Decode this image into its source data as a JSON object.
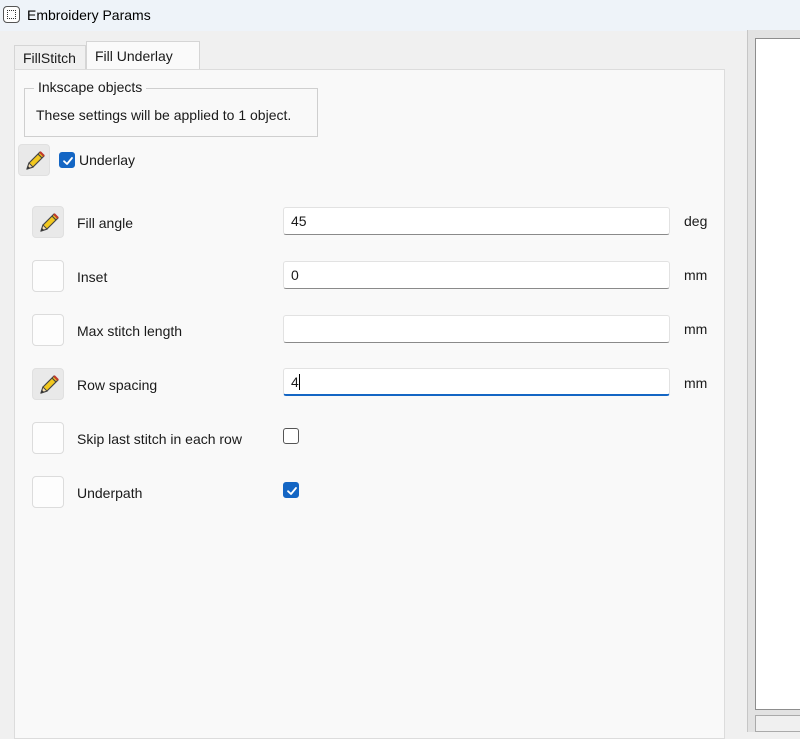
{
  "window": {
    "title": "Embroidery Params"
  },
  "tabs": [
    {
      "label": "FillStitch",
      "active": false
    },
    {
      "label": "Fill Underlay",
      "active": true
    }
  ],
  "group": {
    "title": "Inkscape objects",
    "text": "These settings will be applied to 1 object."
  },
  "underlay": {
    "label": "Underlay",
    "checked": true
  },
  "params": [
    {
      "label": "Fill angle",
      "value": "45",
      "unit": "deg",
      "edited": true
    },
    {
      "label": "Inset",
      "value": "0",
      "unit": "mm",
      "edited": false
    },
    {
      "label": "Max stitch length",
      "value": "",
      "unit": "mm",
      "edited": false
    },
    {
      "label": "Row spacing",
      "value": "4",
      "unit": "mm",
      "edited": true,
      "focused": true
    },
    {
      "label": "Skip last stitch in each row",
      "checked": false,
      "edited": false
    },
    {
      "label": "Underpath",
      "checked": true,
      "edited": false
    }
  ],
  "colors": {
    "accent": "#1466c4"
  }
}
